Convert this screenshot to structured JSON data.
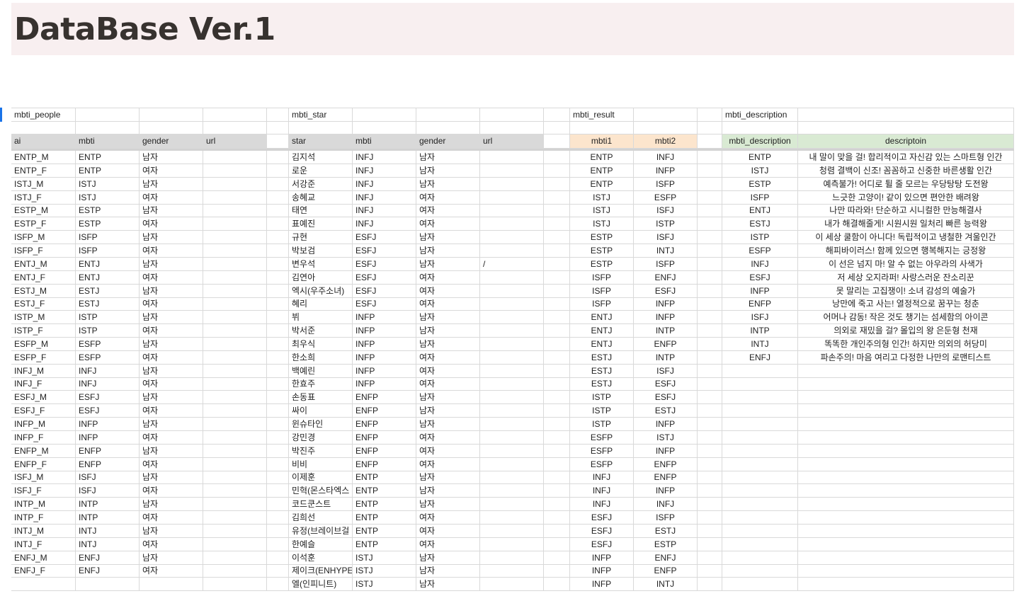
{
  "page": {
    "title": "DataBase Ver.1"
  },
  "sheet": {
    "row1": {
      "c0": "mbti_people",
      "c5": "mbti_star",
      "c10": "mbti_result",
      "c13": "mbti_description"
    },
    "headers": [
      "ai",
      "mbti",
      "gender",
      "url",
      "",
      "star",
      "mbti",
      "gender",
      "url",
      "",
      "mbti1",
      "mbti2",
      "",
      "mbti_description",
      "descriptoin"
    ],
    "rows": [
      [
        "ENTP_M",
        "ENTP",
        "남자",
        "",
        "",
        "김지석",
        "INFJ",
        "남자",
        "",
        "",
        "ENTP",
        "INFJ",
        "",
        "ENTP",
        "내 말이 맞을 걸! 합리적이고 자신감 있는 스마트형 인간"
      ],
      [
        "ENTP_F",
        "ENTP",
        "여자",
        "",
        "",
        "로운",
        "INFJ",
        "남자",
        "",
        "",
        "ENTP",
        "INFP",
        "",
        "ISTJ",
        "청렴 결백이 신조! 꼼꼼하고 신중한 바른생활 인간"
      ],
      [
        "ISTJ_M",
        "ISTJ",
        "남자",
        "",
        "",
        "서강준",
        "INFJ",
        "남자",
        "",
        "",
        "ENTP",
        "ISFP",
        "",
        "ESTP",
        "예측불가! 어디로 튈 줄 모르는 우당탕탕 도전왕"
      ],
      [
        "ISTJ_F",
        "ISTJ",
        "여자",
        "",
        "",
        "송혜교",
        "INFJ",
        "여자",
        "",
        "",
        "ISTJ",
        "ESFP",
        "",
        "ISFP",
        "느긋한 고양이! 같이 있으면 편안한 배려왕"
      ],
      [
        "ESTP_M",
        "ESTP",
        "남자",
        "",
        "",
        "태연",
        "INFJ",
        "여자",
        "",
        "",
        "ISTJ",
        "ISFJ",
        "",
        "ENTJ",
        "나만 따라와! 단순하고 시니컬한 만능해결사"
      ],
      [
        "ESTP_F",
        "ESTP",
        "여자",
        "",
        "",
        "표예진",
        "INFJ",
        "여자",
        "",
        "",
        "ISTJ",
        "ISTP",
        "",
        "ESTJ",
        "내가 해결해줄게! 시원시원 일처리 빠른 능력왕"
      ],
      [
        "ISFP_M",
        "ISFP",
        "남자",
        "",
        "",
        "규현",
        "ESFJ",
        "남자",
        "",
        "",
        "ESTP",
        "ISFJ",
        "",
        "ISTP",
        "이 세상 쿨함이 아니다! 독립적이고 냉철한 겨울인간"
      ],
      [
        "ISFP_F",
        "ISFP",
        "여자",
        "",
        "",
        "박보검",
        "ESFJ",
        "남자",
        "",
        "",
        "ESTP",
        "INTJ",
        "",
        "ESFP",
        "해피바이러스! 함께 있으면 행복해지는 긍정왕"
      ],
      [
        "ENTJ_M",
        "ENTJ",
        "남자",
        "",
        "",
        "변우석",
        "ESFJ",
        "남자",
        "/",
        "",
        "ESTP",
        "ISFP",
        "",
        "INFJ",
        "이 선은 넘지 마! 알 수 없는 아우라의 사색가"
      ],
      [
        "ENTJ_F",
        "ENTJ",
        "여자",
        "",
        "",
        "김연아",
        "ESFJ",
        "여자",
        "",
        "",
        "ISFP",
        "ENFJ",
        "",
        "ESFJ",
        "저 세상 오지라퍼! 사랑스러운 잔소리꾼"
      ],
      [
        "ESTJ_M",
        "ESTJ",
        "남자",
        "",
        "",
        "엑시(우주소녀)",
        "ESFJ",
        "여자",
        "",
        "",
        "ISFP",
        "ESFJ",
        "",
        "INFP",
        "못 말리는 고집쟁이! 소녀 감성의 예술가"
      ],
      [
        "ESTJ_F",
        "ESTJ",
        "여자",
        "",
        "",
        "혜리",
        "ESFJ",
        "여자",
        "",
        "",
        "ISFP",
        "INFP",
        "",
        "ENFP",
        "낭만에 죽고 사는! 열정적으로 꿈꾸는 청춘"
      ],
      [
        "ISTP_M",
        "ISTP",
        "남자",
        "",
        "",
        "뷔",
        "INFP",
        "남자",
        "",
        "",
        "ENTJ",
        "INFP",
        "",
        "ISFJ",
        "어머나 감동! 작은 것도 챙기는 섬세함의 아이콘"
      ],
      [
        "ISTP_F",
        "ISTP",
        "여자",
        "",
        "",
        "박서준",
        "INFP",
        "남자",
        "",
        "",
        "ENTJ",
        "INTP",
        "",
        "INTP",
        "의외로 재밌을 걸? 몰입의 왕 은둔형 천재"
      ],
      [
        "ESFP_M",
        "ESFP",
        "남자",
        "",
        "",
        "최우식",
        "INFP",
        "남자",
        "",
        "",
        "ENTJ",
        "ENFP",
        "",
        "INTJ",
        "똑똑한 개인주의형 인간! 하지만 의외의 허당미"
      ],
      [
        "ESFP_F",
        "ESFP",
        "여자",
        "",
        "",
        "한소희",
        "INFP",
        "여자",
        "",
        "",
        "ESTJ",
        "INTP",
        "",
        "ENFJ",
        "파손주의! 마음 여리고 다정한 나만의 로맨티스트"
      ],
      [
        "INFJ_M",
        "INFJ",
        "남자",
        "",
        "",
        "백예린",
        "INFP",
        "여자",
        "",
        "",
        "ESTJ",
        "ISFJ",
        "",
        "",
        ""
      ],
      [
        "INFJ_F",
        "INFJ",
        "여자",
        "",
        "",
        "한효주",
        "INFP",
        "여자",
        "",
        "",
        "ESTJ",
        "ESFJ",
        "",
        "",
        ""
      ],
      [
        "ESFJ_M",
        "ESFJ",
        "남자",
        "",
        "",
        "손동표",
        "ENFP",
        "남자",
        "",
        "",
        "ISTP",
        "ESFJ",
        "",
        "",
        ""
      ],
      [
        "ESFJ_F",
        "ESFJ",
        "여자",
        "",
        "",
        "싸이",
        "ENFP",
        "남자",
        "",
        "",
        "ISTP",
        "ESTJ",
        "",
        "",
        ""
      ],
      [
        "INFP_M",
        "INFP",
        "남자",
        "",
        "",
        "윈슈타인",
        "ENFP",
        "남자",
        "",
        "",
        "ISTP",
        "INFP",
        "",
        "",
        ""
      ],
      [
        "INFP_F",
        "INFP",
        "여자",
        "",
        "",
        "강민경",
        "ENFP",
        "여자",
        "",
        "",
        "ESFP",
        "ISTJ",
        "",
        "",
        ""
      ],
      [
        "ENFP_M",
        "ENFP",
        "남자",
        "",
        "",
        "박진주",
        "ENFP",
        "여자",
        "",
        "",
        "ESFP",
        "INFP",
        "",
        "",
        ""
      ],
      [
        "ENFP_F",
        "ENFP",
        "여자",
        "",
        "",
        "비비",
        "ENFP",
        "여자",
        "",
        "",
        "ESFP",
        "ENFP",
        "",
        "",
        ""
      ],
      [
        "ISFJ_M",
        "ISFJ",
        "남자",
        "",
        "",
        "이제훈",
        "ENTP",
        "남자",
        "",
        "",
        "INFJ",
        "ENFP",
        "",
        "",
        ""
      ],
      [
        "ISFJ_F",
        "ISFJ",
        "여자",
        "",
        "",
        "민혁(몬스타엑스",
        "ENTP",
        "남자",
        "",
        "",
        "INFJ",
        "INFP",
        "",
        "",
        ""
      ],
      [
        "INTP_M",
        "INTP",
        "남자",
        "",
        "",
        "코드쿤스트",
        "ENTP",
        "남자",
        "",
        "",
        "INFJ",
        "INFJ",
        "",
        "",
        ""
      ],
      [
        "INTP_F",
        "INTP",
        "여자",
        "",
        "",
        "김희선",
        "ENTP",
        "여자",
        "",
        "",
        "ESFJ",
        "ISFP",
        "",
        "",
        ""
      ],
      [
        "INTJ_M",
        "INTJ",
        "남자",
        "",
        "",
        "유정(브레이브걸",
        "ENTP",
        "여자",
        "",
        "",
        "ESFJ",
        "ESTJ",
        "",
        "",
        ""
      ],
      [
        "INTJ_F",
        "INTJ",
        "여자",
        "",
        "",
        "한예슬",
        "ENTP",
        "여자",
        "",
        "",
        "ESFJ",
        "ESTP",
        "",
        "",
        ""
      ],
      [
        "ENFJ_M",
        "ENFJ",
        "남자",
        "",
        "",
        "이석훈",
        "ISTJ",
        "남자",
        "",
        "",
        "INFP",
        "ENFJ",
        "",
        "",
        ""
      ],
      [
        "ENFJ_F",
        "ENFJ",
        "여자",
        "",
        "",
        "제이크(ENHYPE",
        "ISTJ",
        "남자",
        "",
        "",
        "INFP",
        "ENFP",
        "",
        "",
        ""
      ],
      [
        "",
        "",
        "",
        "",
        "",
        "엘(인피니트)",
        "ISTJ",
        "남자",
        "",
        "",
        "INFP",
        "INTJ",
        "",
        "",
        ""
      ]
    ]
  },
  "colors": {
    "header_gray": "#d9d9d9",
    "header_orange": "#fce5cd",
    "header_green": "#d9ead3",
    "title_band": "#f8eff0",
    "selection": "#1a73e8"
  }
}
